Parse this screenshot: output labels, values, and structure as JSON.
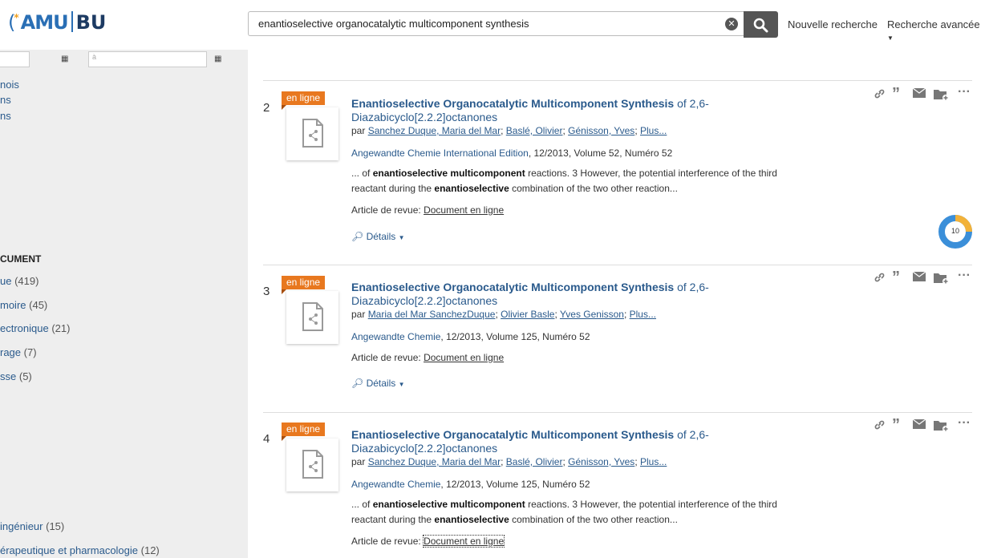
{
  "header": {
    "logo_amu": "AMU",
    "logo_bu": "BU",
    "search_value": "enantioselective organocatalytic multicomponent synthesis",
    "new_search": "Nouvelle recherche",
    "advanced_search": "Recherche avancée"
  },
  "sidebar": {
    "date_to_placeholder": "à",
    "links_top": [
      "nois",
      "ns",
      "ns"
    ],
    "section_title": "CUMENT",
    "doc_types": [
      {
        "label": "ue",
        "count": "(419)"
      },
      {
        "label": "moire",
        "count": "(45)"
      },
      {
        "label": "ectronique",
        "count": "(21)"
      },
      {
        "label": "rage",
        "count": "(7)"
      },
      {
        "label": "sse",
        "count": "(5)"
      }
    ],
    "disciplines": [
      {
        "label": "ingénieur",
        "count": "(15)"
      },
      {
        "label": "érapeutique et pharmacologie",
        "count": "(12)"
      }
    ]
  },
  "results": [
    {
      "num": "2",
      "badge": "en ligne",
      "title_bold": "Enantioselective Organocatalytic Multicomponent Synthesis",
      "title_rest": " of 2,6-Diazabicyclo[2.2.2]octanones",
      "by": "par",
      "authors": [
        "Sanchez Duque, Maria del Mar",
        "Baslé, Olivier",
        "Génisson, Yves",
        "Plus..."
      ],
      "journal": "Angewandte Chemie International Edition",
      "source_rest": ", 12/2013, Volume 52, Numéro 52",
      "snippet_1a": "... of ",
      "snippet_1b": "enantioselective multicomponent",
      "snippet_1c": " reactions. 3 However, the potential interference of the third",
      "snippet_2a": "reactant during the ",
      "snippet_2b": "enantioselective",
      "snippet_2c": " combination of the two other reaction...",
      "doctype_label": "Article de revue:",
      "doctype_link": "Document en ligne",
      "details": "Détails"
    },
    {
      "num": "3",
      "badge": "en ligne",
      "title_bold": "Enantioselective Organocatalytic Multicomponent Synthesis",
      "title_rest": " of 2,6-Diazabicyclo[2.2.2]octanones",
      "by": "par",
      "authors": [
        "Maria del Mar SanchezDuque",
        "Olivier Basle",
        "Yves Genisson",
        "Plus..."
      ],
      "journal": "Angewandte Chemie",
      "source_rest": ", 12/2013, Volume 125, Numéro 52",
      "doctype_label": "Article de revue:",
      "doctype_link": "Document en ligne",
      "details": "Détails"
    },
    {
      "num": "4",
      "badge": "en ligne",
      "title_bold": "Enantioselective Organocatalytic Multicomponent Synthesis",
      "title_rest": " of 2,6-Diazabicyclo[2.2.2]octanones",
      "by": "par",
      "authors": [
        "Sanchez Duque, Maria del Mar",
        "Baslé, Olivier",
        "Génisson, Yves",
        "Plus..."
      ],
      "journal": "Angewandte Chemie",
      "source_rest": ", 12/2013, Volume 125, Numéro 52",
      "snippet_1a": "... of ",
      "snippet_1b": "enantioselective multicomponent",
      "snippet_1c": " reactions. 3 However, the potential interference of the third",
      "snippet_2a": "reactant during the ",
      "snippet_2b": "enantioselective",
      "snippet_2c": " combination of the two other reaction...",
      "doctype_label": "Article de revue:",
      "doctype_link": "Document en ligne"
    }
  ],
  "altmetric_score": "10",
  "colors": {
    "badge": "#e8781f",
    "link": "#2a5a8c",
    "sidebar_bg": "#eeeeee"
  }
}
